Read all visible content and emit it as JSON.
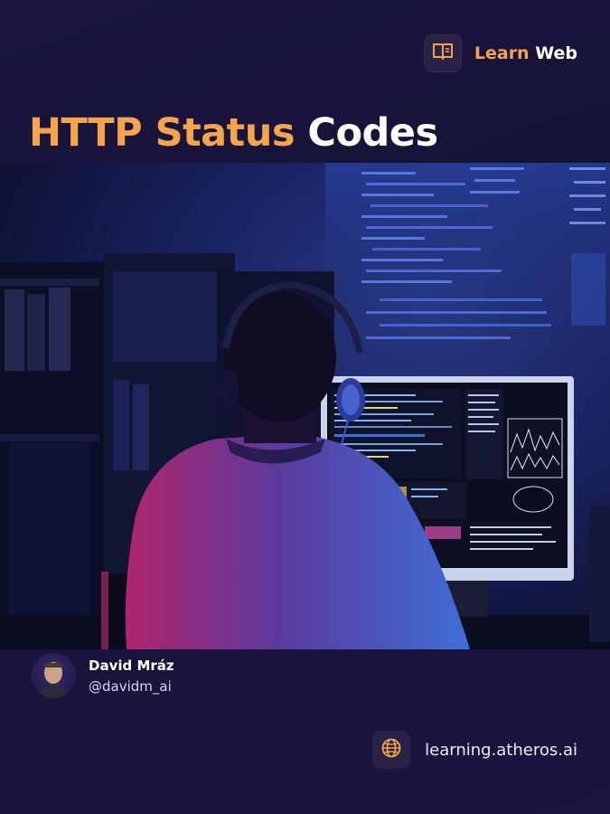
{
  "brand": {
    "icon": "open-book-icon",
    "label_accent": "Learn",
    "label_main": "Web"
  },
  "title": {
    "accent": "HTTP Status",
    "main": "Codes"
  },
  "author": {
    "name": "David Mráz",
    "handle": "@davidm_ai"
  },
  "site": {
    "icon": "globe-icon",
    "label": "learning.atheros.ai"
  },
  "colors": {
    "accent": "#f5a44b",
    "background": "#161238",
    "icon_box": "#2a2246"
  }
}
